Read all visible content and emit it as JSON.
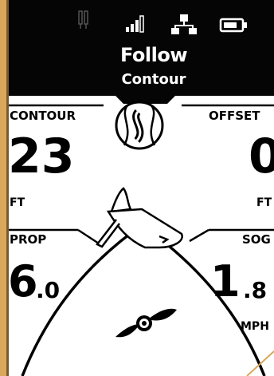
{
  "header": {
    "title": "Follow",
    "subtitle": "Contour",
    "status_icons": [
      "remote-icon",
      "signal-bars-icon",
      "network-icon",
      "battery-icon"
    ]
  },
  "contour": {
    "label": "CONTOUR",
    "value": "23",
    "unit": "FT"
  },
  "offset": {
    "label": "OFFSET",
    "value": "0",
    "unit": "FT"
  },
  "prop": {
    "label": "PROP",
    "value_major": "6",
    "value_minor": ".0"
  },
  "sog": {
    "label": "SOG",
    "value_major": "1",
    "value_minor": ".8",
    "unit": "MPH"
  },
  "colors": {
    "frame": "#d9a85a",
    "header": "#050505",
    "panel": "#ffffff",
    "ink": "#000000"
  }
}
